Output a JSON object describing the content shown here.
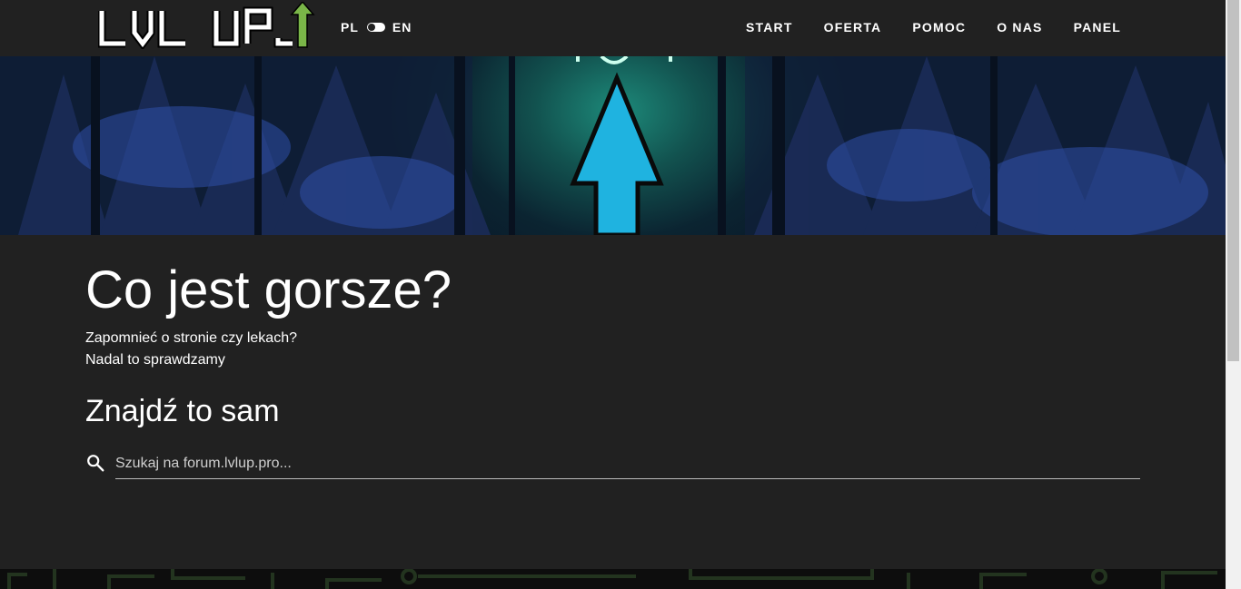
{
  "navbar": {
    "logo_text": "LVL UP",
    "lang": {
      "left": "PL",
      "right": "EN"
    },
    "links": [
      "START",
      "OFERTA",
      "POMOC",
      "O NAS",
      "PANEL"
    ]
  },
  "content": {
    "title": "Co jest gorsze?",
    "line1": "Zapomnieć o stronie czy lekach?",
    "line2": "Nadal to sprawdzamy",
    "subtitle": "Znajdź to sam"
  },
  "search": {
    "icon": "search-icon",
    "placeholder": "Szukaj na forum.lvlup.pro..."
  },
  "colors": {
    "background": "#212121",
    "arrow": "#1fb3e0",
    "logo_arrow": "#7ab648"
  }
}
